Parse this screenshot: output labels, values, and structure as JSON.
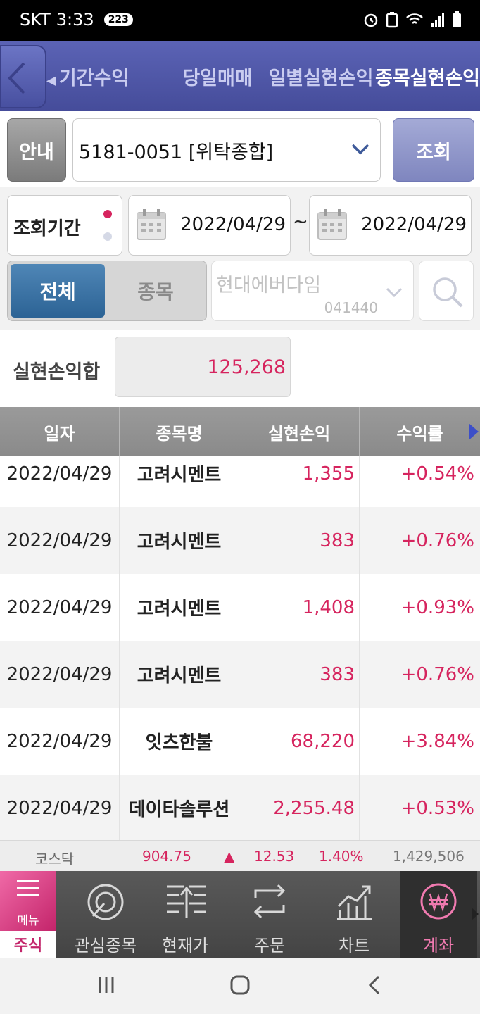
{
  "status": {
    "carrier": "SKT",
    "time": "3:33",
    "badge": "223"
  },
  "nav": {
    "tabs": [
      {
        "label": "기간수익",
        "active": false
      },
      {
        "label": "당일매매",
        "active": false
      },
      {
        "label": "일별실현손익",
        "active": false
      },
      {
        "label": "종목실현손익",
        "active": true
      }
    ]
  },
  "account": {
    "guide_label": "안내",
    "number": "5181-0051 [위탁종합]",
    "query_label": "조회"
  },
  "period": {
    "label": "조회기간",
    "from": "2022/04/29",
    "tilde": "~",
    "to": "2022/04/29"
  },
  "filter": {
    "all_label": "전체",
    "stock_label": "종목",
    "stock_name": "현대에버다임",
    "stock_code": "041440"
  },
  "summary": {
    "label": "실현손익합",
    "value": "125,268"
  },
  "table": {
    "headers": [
      "일자",
      "종목명",
      "실현손익",
      "수익률"
    ],
    "rows": [
      {
        "date": "2022/04/29",
        "name": "고려시멘트",
        "pnl": "1,355",
        "rate": "+0.54%"
      },
      {
        "date": "2022/04/29",
        "name": "고려시멘트",
        "pnl": "383",
        "rate": "+0.76%"
      },
      {
        "date": "2022/04/29",
        "name": "고려시멘트",
        "pnl": "1,408",
        "rate": "+0.93%"
      },
      {
        "date": "2022/04/29",
        "name": "고려시멘트",
        "pnl": "383",
        "rate": "+0.76%"
      },
      {
        "date": "2022/04/29",
        "name": "잇츠한불",
        "pnl": "68,220",
        "rate": "+3.84%"
      },
      {
        "date": "2022/04/29",
        "name": "데이타솔루션",
        "pnl": "2,255.48",
        "rate": "+0.53%"
      }
    ]
  },
  "ticker": {
    "index": "코스닥",
    "value": "904.75",
    "arrow": "▲",
    "change": "12.53",
    "percent": "1.40%",
    "volume": "1,429,506"
  },
  "menu": {
    "menu_label": "메뉴",
    "stock_label": "주식",
    "items": [
      {
        "label": "관심종목",
        "icon": "watchlist-icon"
      },
      {
        "label": "현재가",
        "icon": "price-icon"
      },
      {
        "label": "주문",
        "icon": "order-icon"
      },
      {
        "label": "차트",
        "icon": "chart-icon"
      },
      {
        "label": "계좌",
        "icon": "won-icon"
      }
    ]
  },
  "colors": {
    "accent": "#d6245e",
    "nav": "#4d54a3",
    "primary_button": "#2c6395"
  }
}
